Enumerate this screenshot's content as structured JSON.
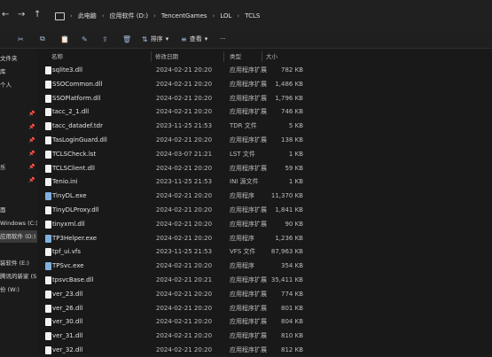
{
  "nav": {
    "back": "←",
    "forward": "→",
    "up": "↑",
    "refresh": "⟳"
  },
  "breadcrumb": {
    "items": [
      "此电脑",
      "应用软件 (D:)",
      "TencentGames",
      "LOL",
      "TCLS"
    ],
    "sep": "›"
  },
  "toolbar": {
    "cut": "✂",
    "copy": "⧉",
    "paste": "📋",
    "rename": "✎",
    "share": "⇪",
    "delete": "🗑",
    "sort_label": "排序",
    "view_label": "查看",
    "more": "···"
  },
  "sidebar": {
    "items": [
      "文件夹",
      "库",
      "个人",
      "",
      "",
      "",
      "",
      "乐",
      "",
      "",
      "面",
      "Windows (C:)",
      "应用软件 (D:)",
      "",
      "",
      "装软件 (E:)",
      "腾讯的新家 (S:)",
      "份 (W:)"
    ]
  },
  "columns": {
    "name": "名称",
    "date": "修改日期",
    "type": "类型",
    "size": "大小"
  },
  "files": [
    {
      "name": "sqlite3.dll",
      "date": "2024-02-21 20:20",
      "type": "应用程序扩展",
      "size": "782 KB"
    },
    {
      "name": "SSOCommon.dll",
      "date": "2024-02-21 20:20",
      "type": "应用程序扩展",
      "size": "1,486 KB"
    },
    {
      "name": "SSOPlatform.dll",
      "date": "2024-02-21 20:20",
      "type": "应用程序扩展",
      "size": "1,796 KB"
    },
    {
      "name": "tacc_2_1.dll",
      "date": "2024-02-21 20:20",
      "type": "应用程序扩展",
      "size": "746 KB"
    },
    {
      "name": "tacc_datadef.tdr",
      "date": "2023-11-25 21:53",
      "type": "TDR 文件",
      "size": "5 KB"
    },
    {
      "name": "TasLoginGuard.dll",
      "date": "2024-02-21 20:20",
      "type": "应用程序扩展",
      "size": "138 KB"
    },
    {
      "name": "TCLSCheck.lst",
      "date": "2024-03-07 21:21",
      "type": "LST 文件",
      "size": "1 KB"
    },
    {
      "name": "TCLSClient.dll",
      "date": "2024-02-21 20:20",
      "type": "应用程序扩展",
      "size": "59 KB"
    },
    {
      "name": "Tenio.ini",
      "date": "2023-11-25 21:53",
      "type": "INI 源文件",
      "size": "1 KB"
    },
    {
      "name": "TinyDL.exe",
      "date": "2024-02-21 20:20",
      "type": "应用程序",
      "size": "11,370 KB"
    },
    {
      "name": "TinyDLProxy.dll",
      "date": "2024-02-21 20:20",
      "type": "应用程序扩展",
      "size": "1,841 KB"
    },
    {
      "name": "tinyxml.dll",
      "date": "2024-02-21 20:20",
      "type": "应用程序扩展",
      "size": "90 KB"
    },
    {
      "name": "TP3Helper.exe",
      "date": "2024-02-21 20:20",
      "type": "应用程序",
      "size": "1,236 KB"
    },
    {
      "name": "tpf_ui.vfs",
      "date": "2023-11-25 21:53",
      "type": "VFS 文件",
      "size": "87,963 KB"
    },
    {
      "name": "TPSvc.exe",
      "date": "2024-02-21 20:20",
      "type": "应用程序",
      "size": "354 KB"
    },
    {
      "name": "tpsvcBase.dll",
      "date": "2024-02-21 20:21",
      "type": "应用程序扩展",
      "size": "35,411 KB"
    },
    {
      "name": "ver_23.dll",
      "date": "2024-02-21 20:20",
      "type": "应用程序扩展",
      "size": "774 KB"
    },
    {
      "name": "ver_26.dll",
      "date": "2024-02-21 20:20",
      "type": "应用程序扩展",
      "size": "801 KB"
    },
    {
      "name": "ver_30.dll",
      "date": "2024-02-21 20:20",
      "type": "应用程序扩展",
      "size": "804 KB"
    },
    {
      "name": "ver_31.dll",
      "date": "2024-02-21 20:20",
      "type": "应用程序扩展",
      "size": "810 KB"
    },
    {
      "name": "ver_32.dll",
      "date": "2024-02-21 20:20",
      "type": "应用程序扩展",
      "size": "812 KB"
    }
  ]
}
